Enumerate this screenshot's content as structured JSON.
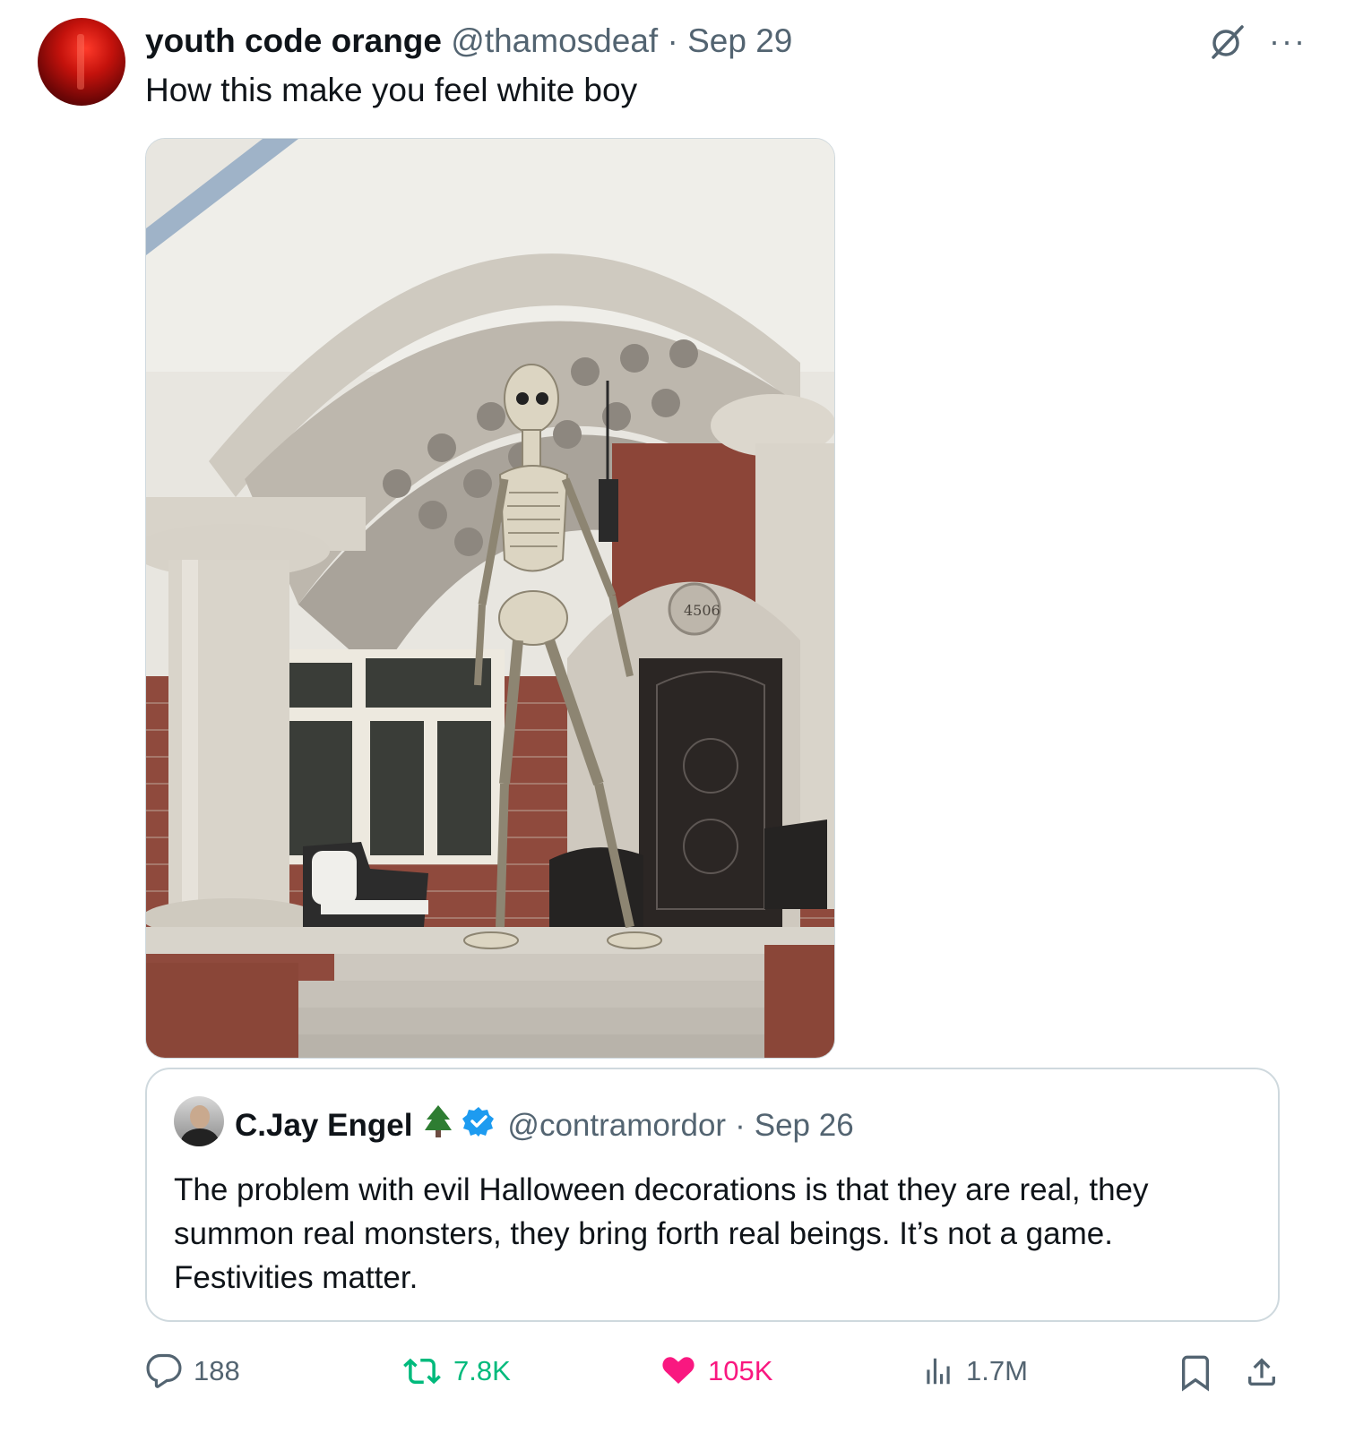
{
  "post": {
    "author_name": "youth code orange",
    "handle": "@thamosdeaf",
    "separator": "·",
    "date": "Sep 29",
    "text": "How this make you feel white boy"
  },
  "icons": {
    "grok": "grok-icon",
    "more": "···"
  },
  "media": {
    "house_number": "4506"
  },
  "quote": {
    "author_name": "C.Jay Engel",
    "emoji": "🌲",
    "handle": "@contramordor",
    "separator": "·",
    "date": "Sep 26",
    "text": "The problem with evil Halloween decorations is that they are real, they summon real monsters, they bring forth real beings. It’s not a game. Festivities matter."
  },
  "stats": {
    "replies": "188",
    "reposts": "7.8K",
    "likes": "105K",
    "views": "1.7M"
  },
  "colors": {
    "text": "#0f1419",
    "muted": "#536471",
    "border": "#cfd9de",
    "retweet": "#00ba7c",
    "like": "#f91880",
    "verified": "#1d9bf0"
  }
}
